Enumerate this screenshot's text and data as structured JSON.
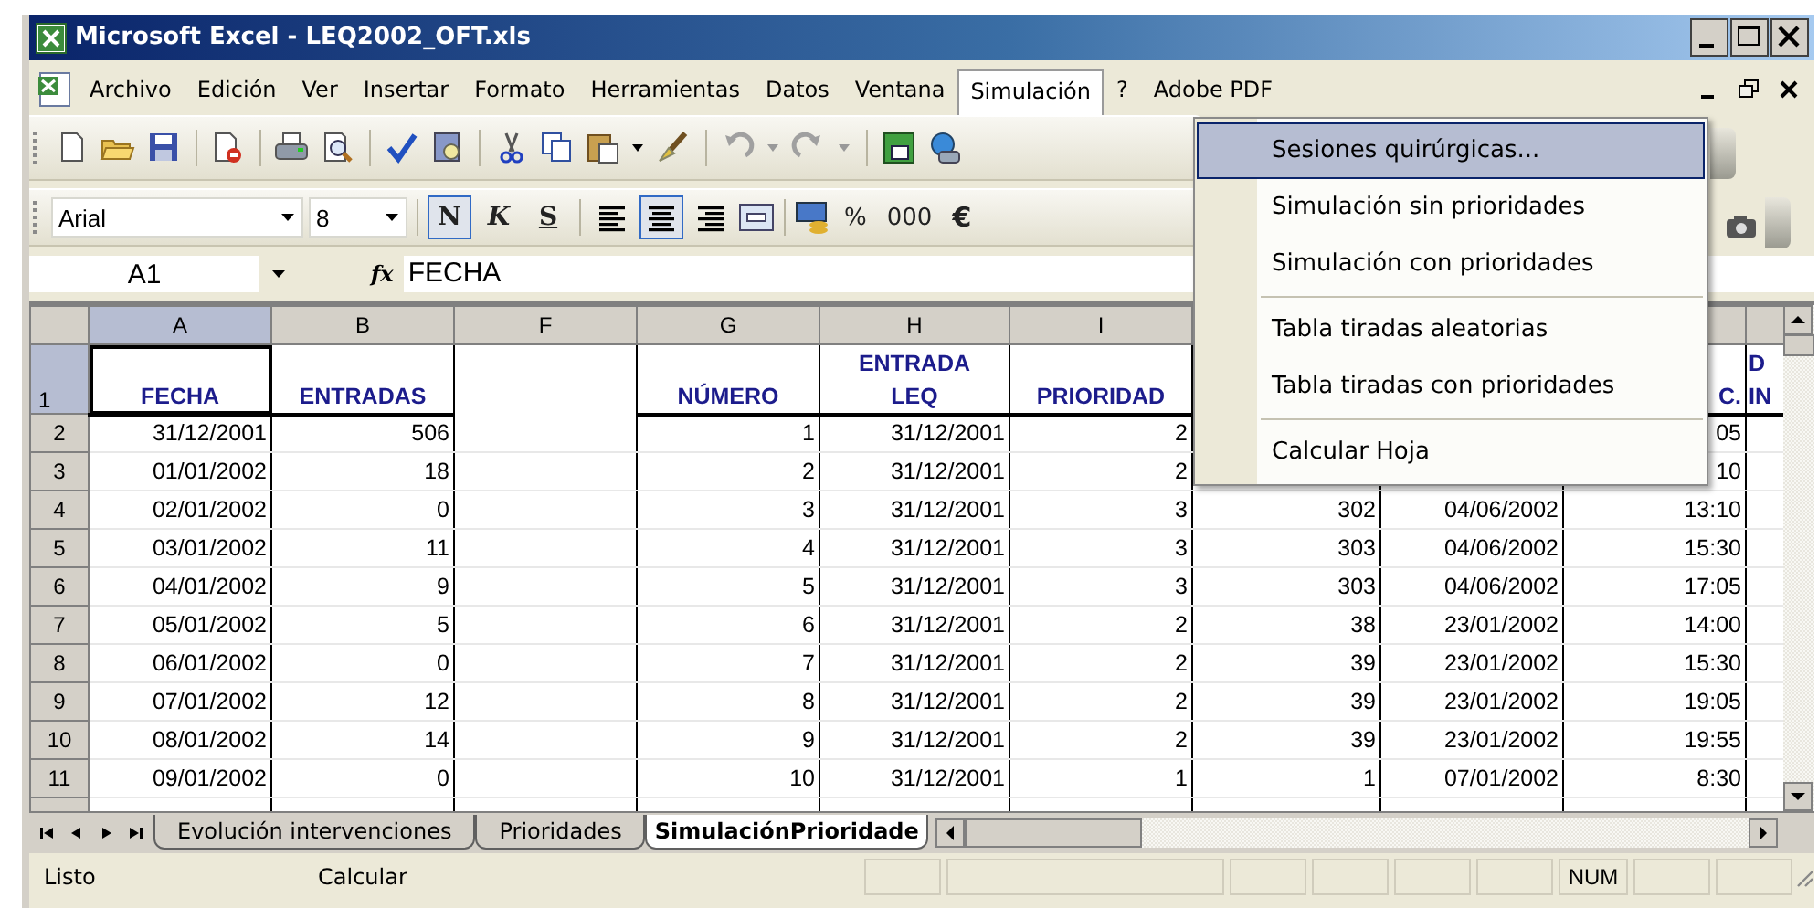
{
  "window": {
    "title": "Microsoft Excel - LEQ2002_OFT.xls"
  },
  "menu_bar": [
    {
      "label": "Archivo",
      "selected": false
    },
    {
      "label": "Edición",
      "selected": false
    },
    {
      "label": "Ver",
      "selected": false
    },
    {
      "label": "Insertar",
      "selected": false
    },
    {
      "label": "Formato",
      "selected": false
    },
    {
      "label": "Herramientas",
      "selected": false
    },
    {
      "label": "Datos",
      "selected": false
    },
    {
      "label": "Ventana",
      "selected": false
    },
    {
      "label": "Simulación",
      "selected": true
    },
    {
      "label": "?",
      "selected": false
    },
    {
      "label": "Adobe PDF",
      "selected": false
    }
  ],
  "dropdown_menu": [
    {
      "kind": "item",
      "label": "Sesiones quirúrgicas...",
      "selected": true
    },
    {
      "kind": "item",
      "label": "Simulación sin prioridades",
      "selected": false
    },
    {
      "kind": "item",
      "label": "Simulación con prioridades",
      "selected": false
    },
    {
      "kind": "separator"
    },
    {
      "kind": "item",
      "label": "Tabla tiradas aleatorias",
      "selected": false
    },
    {
      "kind": "item",
      "label": "Tabla tiradas con prioridades",
      "selected": false
    },
    {
      "kind": "separator"
    },
    {
      "kind": "item",
      "label": "Calcular Hoja",
      "selected": false
    }
  ],
  "formatting_toolbar": {
    "font": "Arial",
    "size": "8",
    "style_buttons": [
      {
        "label": "N",
        "pressed": true
      },
      {
        "label": "K",
        "pressed": false
      },
      {
        "label": "S",
        "pressed": false
      }
    ],
    "align_buttons": [
      {
        "pressed": false
      },
      {
        "pressed": true
      },
      {
        "pressed": false
      }
    ],
    "number_buttons": [
      "%",
      "000",
      "€"
    ]
  },
  "formula_bar": {
    "name_box": "A1",
    "fx": "fx",
    "formula": "FECHA"
  },
  "sheet": {
    "columns": [
      {
        "label": "A",
        "selected": true
      },
      {
        "label": "B",
        "selected": false
      },
      {
        "label": "F",
        "selected": false
      },
      {
        "label": "G",
        "selected": false
      },
      {
        "label": "H",
        "selected": false
      },
      {
        "label": "I",
        "selected": false
      }
    ],
    "header_row": {
      "header": "1",
      "selected": true,
      "cells": [
        [
          "FECHA"
        ],
        [
          "ENTRADAS"
        ],
        null,
        [
          "NÚMERO"
        ],
        [
          "ENTRADA",
          "LEQ"
        ],
        [
          "PRIORIDAD"
        ],
        null,
        null,
        [
          "C."
        ],
        [
          "D",
          "IN"
        ]
      ]
    },
    "rows": [
      {
        "header": "2",
        "selected": false,
        "cells": [
          "31/12/2001",
          "506",
          null,
          "1",
          "31/12/2001",
          "2",
          null,
          null,
          "05",
          null
        ]
      },
      {
        "header": "3",
        "selected": false,
        "cells": [
          "01/01/2002",
          "18",
          null,
          "2",
          "31/12/2001",
          "2",
          null,
          null,
          "10",
          null
        ]
      },
      {
        "header": "4",
        "selected": false,
        "cells": [
          "02/01/2002",
          "0",
          null,
          "3",
          "31/12/2001",
          "3",
          "302",
          "04/06/2002",
          "13:10",
          null
        ]
      },
      {
        "header": "5",
        "selected": false,
        "cells": [
          "03/01/2002",
          "11",
          null,
          "4",
          "31/12/2001",
          "3",
          "303",
          "04/06/2002",
          "15:30",
          null
        ]
      },
      {
        "header": "6",
        "selected": false,
        "cells": [
          "04/01/2002",
          "9",
          null,
          "5",
          "31/12/2001",
          "3",
          "303",
          "04/06/2002",
          "17:05",
          null
        ]
      },
      {
        "header": "7",
        "selected": false,
        "cells": [
          "05/01/2002",
          "5",
          null,
          "6",
          "31/12/2001",
          "2",
          "38",
          "23/01/2002",
          "14:00",
          null
        ]
      },
      {
        "header": "8",
        "selected": false,
        "cells": [
          "06/01/2002",
          "0",
          null,
          "7",
          "31/12/2001",
          "2",
          "39",
          "23/01/2002",
          "15:30",
          null
        ]
      },
      {
        "header": "9",
        "selected": false,
        "cells": [
          "07/01/2002",
          "12",
          null,
          "8",
          "31/12/2001",
          "2",
          "39",
          "23/01/2002",
          "19:05",
          null
        ]
      },
      {
        "header": "10",
        "selected": false,
        "cells": [
          "08/01/2002",
          "14",
          null,
          "9",
          "31/12/2001",
          "2",
          "39",
          "23/01/2002",
          "19:55",
          null
        ]
      },
      {
        "header": "11",
        "selected": false,
        "cells": [
          "09/01/2002",
          "0",
          null,
          "10",
          "31/12/2001",
          "1",
          "1",
          "07/01/2002",
          "8:30",
          null
        ]
      }
    ]
  },
  "sheet_tabs": [
    {
      "label": "Evolución intervenciones",
      "selected": false
    },
    {
      "label": "Prioridades",
      "selected": false
    },
    {
      "label": "SimulaciónPrioridade",
      "selected": true
    }
  ],
  "status_bar": {
    "left": "Listo",
    "middle": "Calcular",
    "indicator": "NUM"
  }
}
